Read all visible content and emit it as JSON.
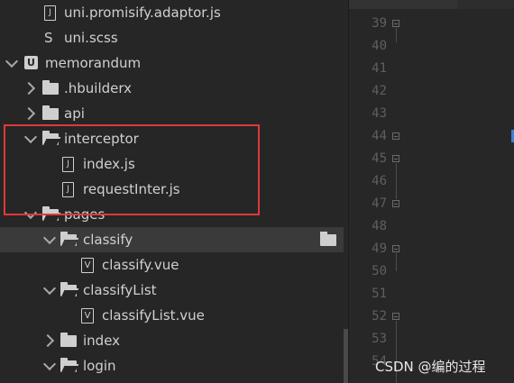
{
  "tree": {
    "items": [
      {
        "label": "uni.promisify.adaptor.js"
      },
      {
        "label": "uni.scss"
      },
      {
        "label": "memorandum"
      },
      {
        "label": ".hbuilderx"
      },
      {
        "label": "api"
      },
      {
        "label": "interceptor"
      },
      {
        "label": "index.js"
      },
      {
        "label": "requestInter.js"
      },
      {
        "label": "pages"
      },
      {
        "label": "classify"
      },
      {
        "label": "classify.vue"
      },
      {
        "label": "classifyList"
      },
      {
        "label": "classifyList.vue"
      },
      {
        "label": "index"
      },
      {
        "label": "login"
      }
    ],
    "icons": {
      "js_glyph": "J",
      "vue_glyph": "V",
      "uni_glyph": "U",
      "scss_glyph": "S"
    },
    "selected_item": "classify"
  },
  "editor": {
    "line_numbers": [
      "39",
      "40",
      "41",
      "42",
      "43",
      "44",
      "45",
      "46",
      "47",
      "48",
      "49",
      "50",
      "51",
      "52",
      "53",
      "54"
    ],
    "fold_markers_at": [
      "39",
      "44",
      "45",
      "47",
      "49",
      "52"
    ]
  },
  "highlight": {
    "color": "#e23838",
    "covers": [
      "interceptor",
      "index.js",
      "requestInter.js"
    ]
  },
  "watermark": "CSDN @编的过程"
}
